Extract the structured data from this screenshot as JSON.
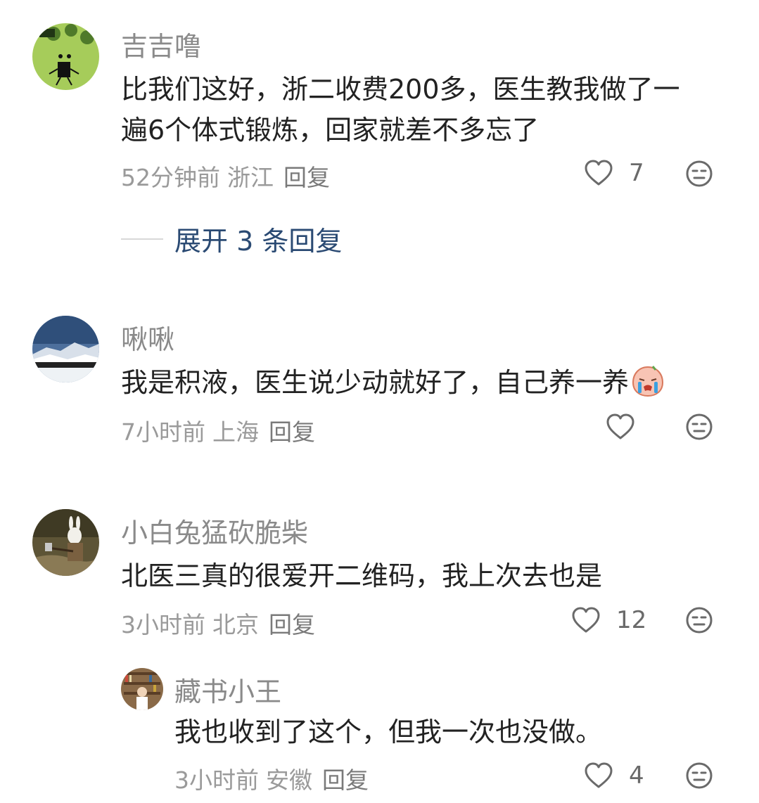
{
  "comments": [
    {
      "username": "吉吉噜",
      "content_line1": "比我们这好，浙二收费200多，医生教我做了一",
      "content_line2": "遍6个体式锻炼，回家就差不多忘了",
      "time": "52分钟前",
      "location": "浙江",
      "reply_label": "回复",
      "likes": "7",
      "expand_label": "展开 3 条回复"
    },
    {
      "username": "啾啾",
      "content": "我是积液，医生说少动就好了，自己养一养",
      "time": "7小时前",
      "location": "上海",
      "reply_label": "回复",
      "likes": ""
    },
    {
      "username": "小白兔猛砍脆柴",
      "content": "北医三真的很爱开二维码，我上次去也是",
      "time": "3小时前",
      "location": "北京",
      "reply_label": "回复",
      "likes": "12"
    },
    {
      "username": "藏书小王",
      "content": "我也收到了这个，但我一次也没做。",
      "time": "3小时前",
      "location": "安徽",
      "reply_label": "回复",
      "likes": "4"
    }
  ],
  "icons": {
    "like": "heart-outline-icon",
    "dislike": "unamused-face-icon",
    "emoji": "crying-face-emoji"
  },
  "colors": {
    "username": "#8a8a8a",
    "text": "#222222",
    "meta": "#9a9a9a",
    "expand": "#2a4a73",
    "icon": "#6a6a6a"
  }
}
